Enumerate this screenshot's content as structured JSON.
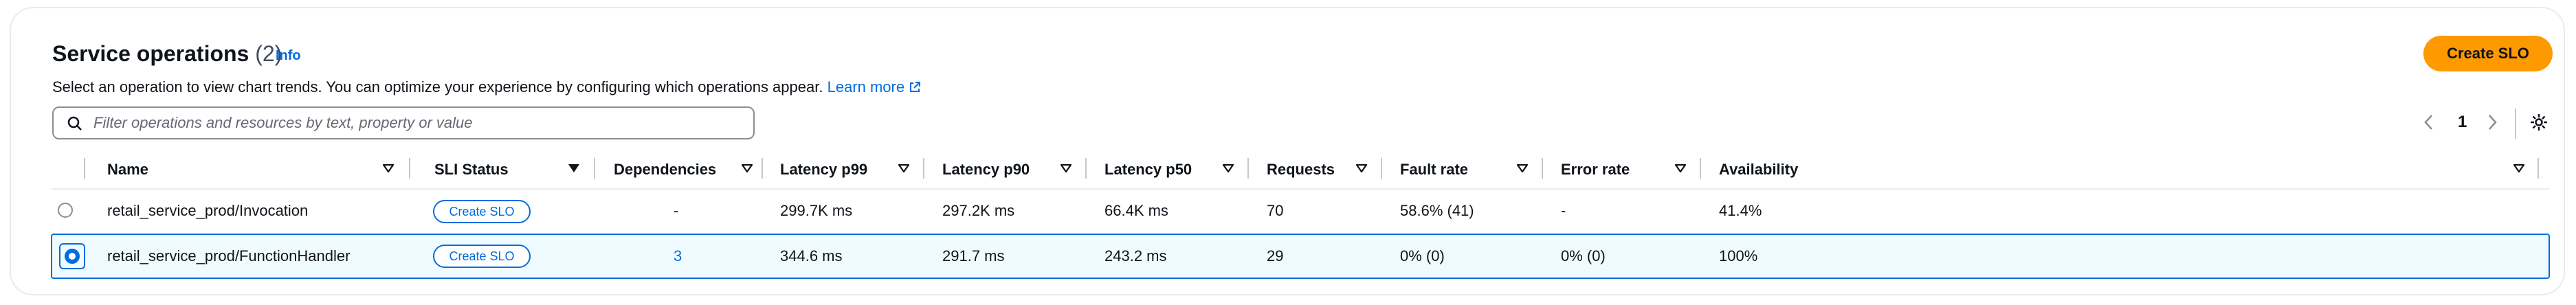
{
  "header": {
    "title": "Service operations",
    "count": "(2)",
    "info_label": "Info",
    "description": "Select an operation to view chart trends. You can optimize your experience by configuring which operations appear.",
    "learn_more": "Learn more",
    "create_slo_label": "Create SLO"
  },
  "filter": {
    "placeholder": "Filter operations and resources by text, property or value"
  },
  "pagination": {
    "current_page": "1"
  },
  "table": {
    "columns": [
      "Name",
      "SLI Status",
      "Dependencies",
      "Latency p99",
      "Latency p90",
      "Latency p50",
      "Requests",
      "Fault rate",
      "Error rate",
      "Availability"
    ],
    "rows": [
      {
        "selected": false,
        "name": "retail_service_prod/Invocation",
        "sli_status": "Create SLO",
        "dependencies": "-",
        "latency_p99": "299.7K ms",
        "latency_p90": "297.2K ms",
        "latency_p50": "66.4K ms",
        "requests": "70",
        "fault_rate": "58.6% (41)",
        "error_rate": "-",
        "availability": "41.4%"
      },
      {
        "selected": true,
        "name": "retail_service_prod/FunctionHandler",
        "sli_status": "Create SLO",
        "dependencies": "3",
        "latency_p99": "344.6 ms",
        "latency_p90": "291.7 ms",
        "latency_p50": "243.2 ms",
        "requests": "29",
        "fault_rate": "0% (0)",
        "error_rate": "0% (0)",
        "availability": "100%"
      }
    ]
  },
  "colors": {
    "accent": "#006ce0",
    "primary_button": "#ff9900",
    "selected_row_bg": "#f0fbff"
  }
}
